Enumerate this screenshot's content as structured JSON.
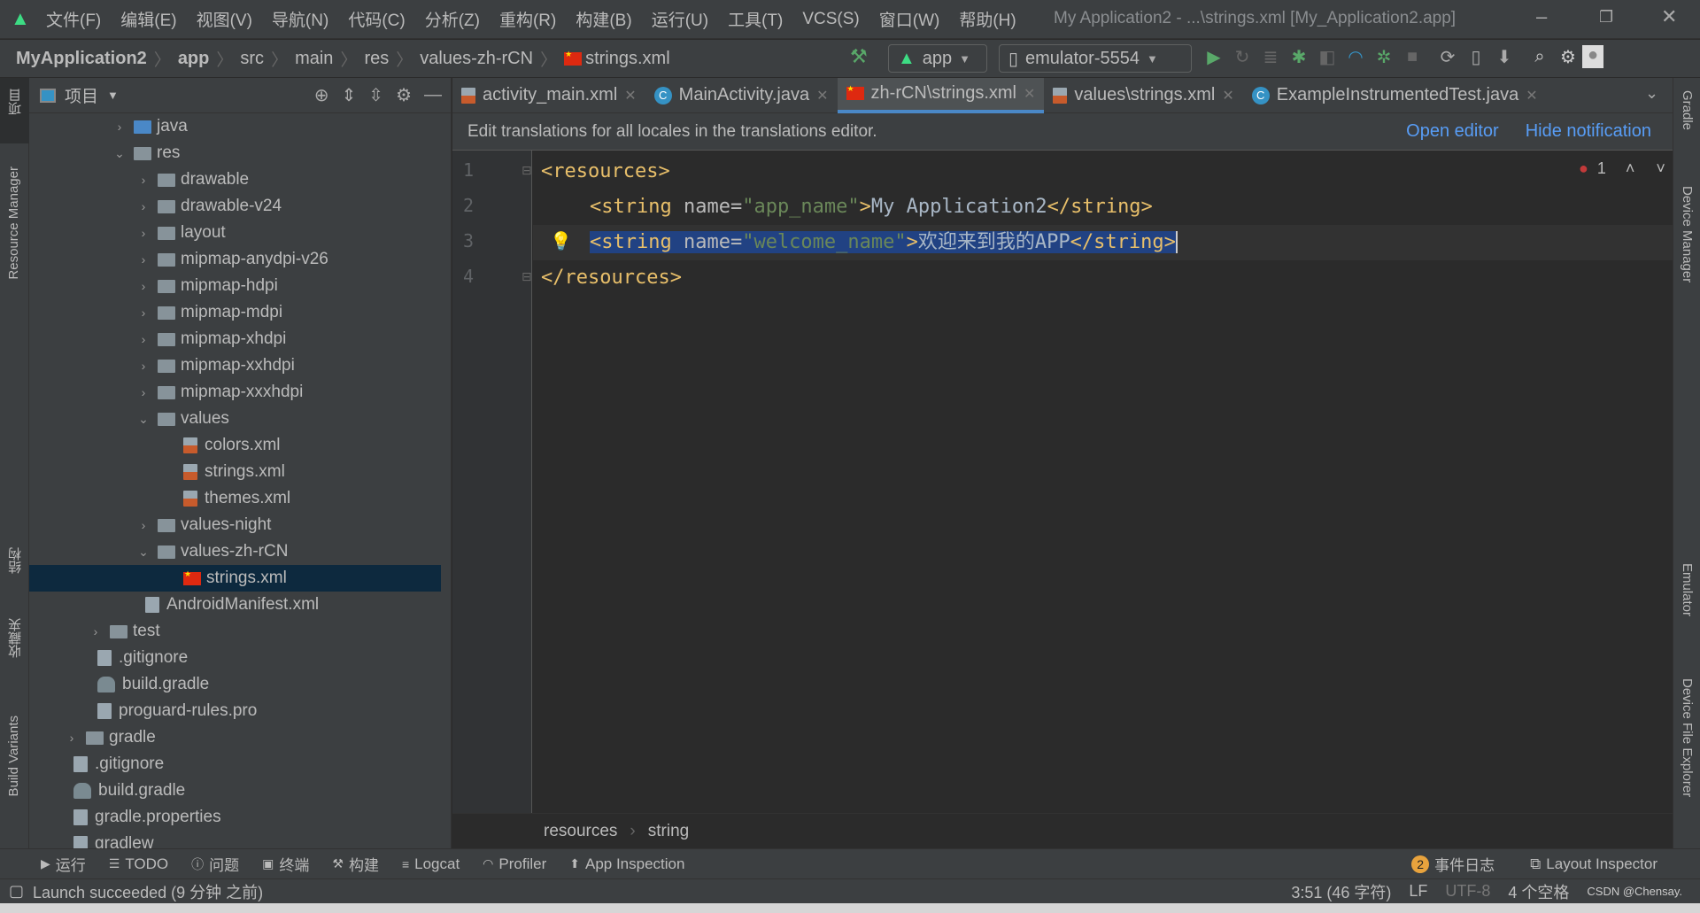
{
  "title_bar": {
    "menus": [
      "文件(F)",
      "编辑(E)",
      "视图(V)",
      "导航(N)",
      "代码(C)",
      "分析(Z)",
      "重构(R)",
      "构建(B)",
      "运行(U)",
      "工具(T)",
      "VCS(S)",
      "窗口(W)",
      "帮助(H)"
    ],
    "window_title": "My Application2 - ...\\strings.xml [My_Application2.app]"
  },
  "breadcrumb": [
    "MyApplication2",
    "app",
    "src",
    "main",
    "res",
    "values-zh-rCN",
    "strings.xml"
  ],
  "run_config": "app",
  "device": "emulator-5554",
  "left_strip": [
    "项目",
    "Resource Manager",
    "结构",
    "收藏夹",
    "Build Variants"
  ],
  "right_strip": [
    "Gradle",
    "Device Manager",
    "Emulator",
    "Device File Explorer"
  ],
  "project_panel": {
    "title": "项目",
    "tree": [
      {
        "label": "java",
        "depth": 2,
        "kind": "folder-blue",
        "arrow": "›"
      },
      {
        "label": "res",
        "depth": 2,
        "kind": "folder",
        "arrow": "⌄"
      },
      {
        "label": "drawable",
        "depth": 3,
        "kind": "folder",
        "arrow": "›"
      },
      {
        "label": "drawable-v24",
        "depth": 3,
        "kind": "folder",
        "arrow": "›"
      },
      {
        "label": "layout",
        "depth": 3,
        "kind": "folder",
        "arrow": "›"
      },
      {
        "label": "mipmap-anydpi-v26",
        "depth": 3,
        "kind": "folder",
        "arrow": "›"
      },
      {
        "label": "mipmap-hdpi",
        "depth": 3,
        "kind": "folder",
        "arrow": "›"
      },
      {
        "label": "mipmap-mdpi",
        "depth": 3,
        "kind": "folder",
        "arrow": "›"
      },
      {
        "label": "mipmap-xhdpi",
        "depth": 3,
        "kind": "folder",
        "arrow": "›"
      },
      {
        "label": "mipmap-xxhdpi",
        "depth": 3,
        "kind": "folder",
        "arrow": "›"
      },
      {
        "label": "mipmap-xxxhdpi",
        "depth": 3,
        "kind": "folder",
        "arrow": "›"
      },
      {
        "label": "values",
        "depth": 3,
        "kind": "folder",
        "arrow": "⌄"
      },
      {
        "label": "colors.xml",
        "depth": 4,
        "kind": "xml"
      },
      {
        "label": "strings.xml",
        "depth": 4,
        "kind": "xml"
      },
      {
        "label": "themes.xml",
        "depth": 4,
        "kind": "xml"
      },
      {
        "label": "values-night",
        "depth": 3,
        "kind": "folder",
        "arrow": "›"
      },
      {
        "label": "values-zh-rCN",
        "depth": 3,
        "kind": "folder",
        "arrow": "⌄"
      },
      {
        "label": "strings.xml",
        "depth": 4,
        "kind": "flag",
        "selected": true
      },
      {
        "label": "AndroidManifest.xml",
        "depth": 3,
        "kind": "file",
        "noarrow": true
      },
      {
        "label": "test",
        "depth": 1,
        "kind": "folder",
        "arrow": "›"
      },
      {
        "label": ".gitignore",
        "depth": 1,
        "kind": "file",
        "noarrow": true
      },
      {
        "label": "build.gradle",
        "depth": 1,
        "kind": "gradle",
        "noarrow": true
      },
      {
        "label": "proguard-rules.pro",
        "depth": 1,
        "kind": "file",
        "noarrow": true
      },
      {
        "label": "gradle",
        "depth": 0,
        "kind": "folder",
        "arrow": "›"
      },
      {
        "label": ".gitignore",
        "depth": 0,
        "kind": "file",
        "noarrow": true
      },
      {
        "label": "build.gradle",
        "depth": 0,
        "kind": "gradle",
        "noarrow": true
      },
      {
        "label": "gradle.properties",
        "depth": 0,
        "kind": "file",
        "noarrow": true
      },
      {
        "label": "gradlew",
        "depth": 0,
        "kind": "file",
        "noarrow": true
      }
    ]
  },
  "tabs": [
    {
      "label": "activity_main.xml",
      "icon": "xml-file-icon"
    },
    {
      "label": "MainActivity.java",
      "icon": "class-icon"
    },
    {
      "label": "zh-rCN\\strings.xml",
      "icon": "flag-icon",
      "active": true
    },
    {
      "label": "values\\strings.xml",
      "icon": "xml-file-icon"
    },
    {
      "label": "ExampleInstrumentedTest.java",
      "icon": "class-icon"
    }
  ],
  "notification": {
    "text": "Edit translations for all locales in the translations editor.",
    "open_editor": "Open editor",
    "hide": "Hide notification"
  },
  "editor": {
    "line_numbers": [
      "1",
      "2",
      "3",
      "4"
    ],
    "error_count": "1",
    "line1": "<resources>",
    "line2": {
      "open": "<string ",
      "attr": "name=",
      "val": "\"app_name\"",
      "close": ">",
      "text": "My Application2",
      "end": "</string>"
    },
    "line3": {
      "open": "<string ",
      "attr": "name=",
      "val": "\"welcome_name\"",
      "close": ">",
      "text": "欢迎来到我的APP",
      "end": "</string>"
    },
    "line4": "</resources>",
    "breadcrumb": [
      "resources",
      "string"
    ]
  },
  "tool_windows": [
    "运行",
    "TODO",
    "问题",
    "终端",
    "构建",
    "Logcat",
    "Profiler",
    "App Inspection"
  ],
  "event_log": {
    "count": "2",
    "label": "事件日志"
  },
  "layout_inspector": "Layout Inspector",
  "status": {
    "message": "Launch succeeded (9 分钟 之前)",
    "position": "3:51 (46 字符)",
    "line_sep": "LF",
    "encoding": "UTF-8",
    "indent": "4 个空格",
    "watermark": "CSDN @Chensay."
  }
}
